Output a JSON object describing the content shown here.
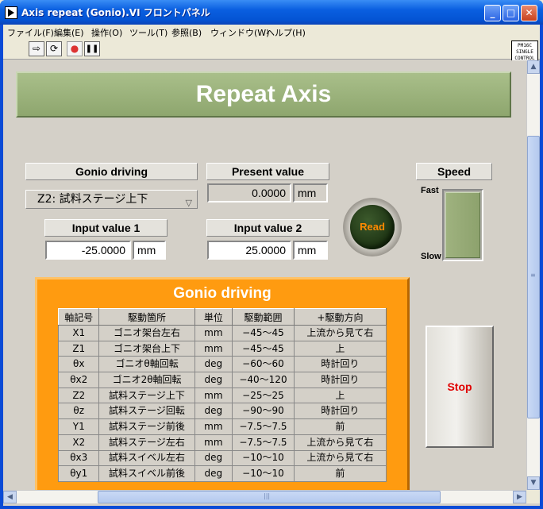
{
  "window": {
    "title": "Axis repeat (Gonio).VI フロントパネル",
    "minimize": "_",
    "maximize": "□",
    "close": "✕"
  },
  "menu": [
    "ファイル(F)",
    "編集(E)",
    "操作(O)",
    "ツール(T)",
    "参照(B)",
    "ウィンドウ(W)",
    "ヘルプ(H)"
  ],
  "toolbar": {
    "run": "⇨",
    "run_continuous": "⟳",
    "abort": "●",
    "pause": "❚❚"
  },
  "connector_icon": [
    "PM16C",
    "SINGLE",
    "CONTROL"
  ],
  "panel": {
    "banner": "Repeat Axis",
    "gonio_driving_label": "Gonio driving",
    "gonio_driving_value": "Z2: 試料ステージ上下",
    "present_value_label": "Present value",
    "present_value": "0.0000",
    "present_unit": "mm",
    "speed_label": "Speed",
    "speed_fast": "Fast",
    "speed_slow": "Slow",
    "speed_level": 1.0,
    "input1_label": "Input value 1",
    "input1_value": "-25.0000",
    "input1_unit": "mm",
    "input2_label": "Input value 2",
    "input2_value": "25.0000",
    "input2_unit": "mm",
    "read_label": "Read",
    "stop_label": "Stop"
  },
  "table": {
    "title": "Gonio driving",
    "headers": [
      "軸記号",
      "駆動箇所",
      "単位",
      "駆動範囲",
      "+駆動方向"
    ],
    "rows": [
      [
        "X1",
        "ゴニオ架台左右",
        "mm",
        "−45〜45",
        "上流から見て右"
      ],
      [
        "Z1",
        "ゴニオ架台上下",
        "mm",
        "−45〜45",
        "上"
      ],
      [
        "θx",
        "ゴニオθ軸回転",
        "deg",
        "−60〜60",
        "時計回り"
      ],
      [
        "θx2",
        "ゴニオ2θ軸回転",
        "deg",
        "−40〜120",
        "時計回り"
      ],
      [
        "Z2",
        "試料ステージ上下",
        "mm",
        "−25〜25",
        "上"
      ],
      [
        "θz",
        "試料ステージ回転",
        "deg",
        "−90〜90",
        "時計回り"
      ],
      [
        "Y1",
        "試料ステージ前後",
        "mm",
        "−7.5〜7.5",
        "前"
      ],
      [
        "X2",
        "試料ステージ左右",
        "mm",
        "−7.5〜7.5",
        "上流から見て右"
      ],
      [
        "θx3",
        "試料スイベル左右",
        "deg",
        "−10〜10",
        "上流から見て右"
      ],
      [
        "θy1",
        "試料スイベル前後",
        "deg",
        "−10〜10",
        "前"
      ]
    ]
  },
  "scrollbars": {
    "up": "▲",
    "down": "▼",
    "left": "◀",
    "right": "▶",
    "grip": "≡",
    "hgrip": "|||"
  }
}
